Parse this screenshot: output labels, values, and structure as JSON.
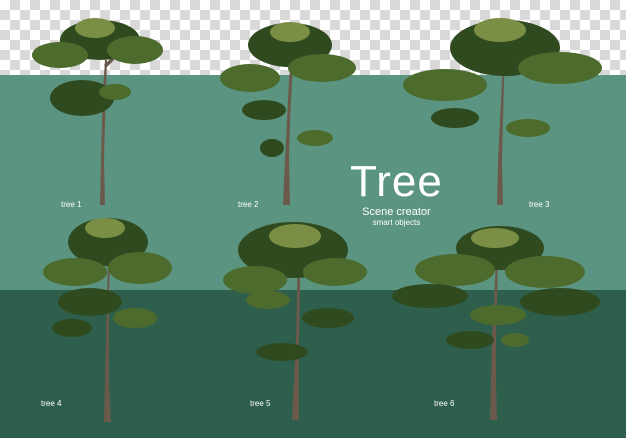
{
  "colors": {
    "background_mid": "#5b9480",
    "background_bottom": "#2e5f4c",
    "foliage_dark": "#2f4a1f",
    "foliage_mid": "#4c6b2c",
    "foliage_light": "#7a8f45",
    "trunk": "#6b5a4c"
  },
  "title": {
    "main": "Tree",
    "subtitle": "Scene creator",
    "tagline": "smart objects"
  },
  "trees": [
    {
      "label": "tree 1"
    },
    {
      "label": "tree 2"
    },
    {
      "label": "tree 3"
    },
    {
      "label": "tree 4"
    },
    {
      "label": "tree 5"
    },
    {
      "label": "tree 6"
    }
  ]
}
